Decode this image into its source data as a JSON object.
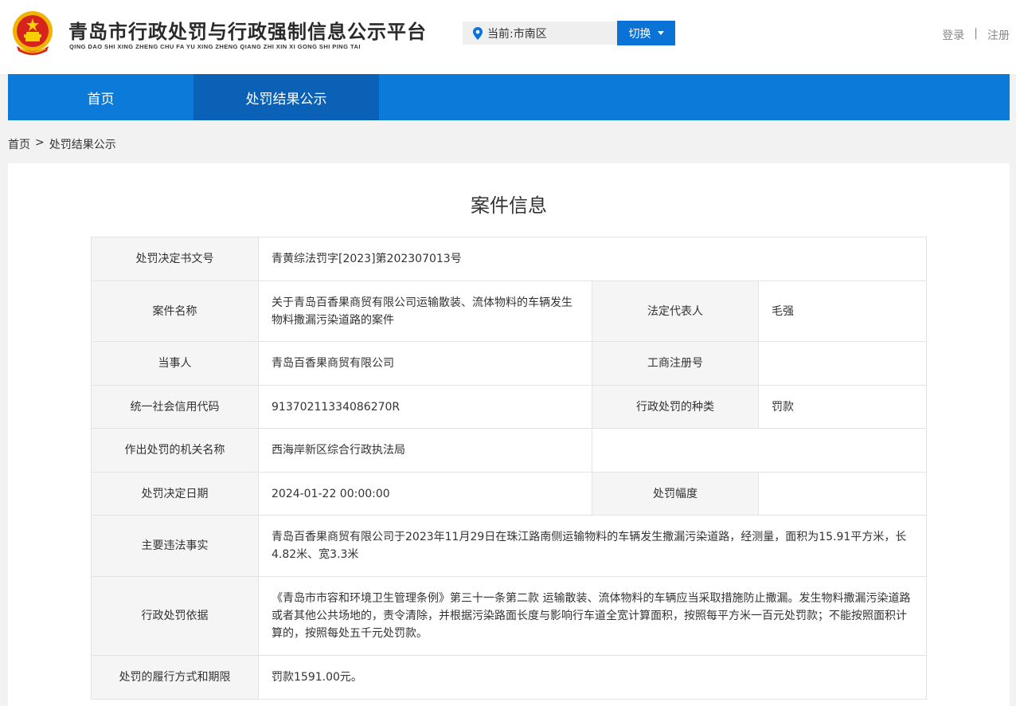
{
  "header": {
    "site_title": "青岛市行政处罚与行政强制信息公示平台",
    "site_subtitle": "QING DAO SHI XING ZHENG CHU FA YU XING ZHENG QIANG ZHI XIN XI GONG SHI PING TAI",
    "location_label": "当前:市南区",
    "switch_label": "切换",
    "login_label": "登录",
    "separator": "|",
    "register_label": "注册",
    "emblem_icon": "national-emblem-icon",
    "pin_icon": "location-pin-icon"
  },
  "nav": {
    "items": [
      {
        "label": "首页"
      },
      {
        "label": "处罚结果公示"
      }
    ],
    "active_index": 1
  },
  "breadcrumb": {
    "home": "首页",
    "separator": ">",
    "current": "处罚结果公示"
  },
  "panel": {
    "title": "案件信息"
  },
  "case": {
    "decision_no_label": "处罚决定书文号",
    "decision_no": "青黄综法罚字[2023]第202307013号",
    "case_name_label": "案件名称",
    "case_name": "关于青岛百香果商贸有限公司运输散装、流体物料的车辆发生物料撒漏污染道路的案件",
    "legal_rep_label": "法定代表人",
    "legal_rep": "毛强",
    "party_label": "当事人",
    "party": "青岛百香果商贸有限公司",
    "reg_no_label": "工商注册号",
    "reg_no": "",
    "credit_code_label": "统一社会信用代码",
    "credit_code": "91370211334086270R",
    "penalty_type_label": "行政处罚的种类",
    "penalty_type": "罚款",
    "authority_label": "作出处罚的机关名称",
    "authority": "西海岸新区综合行政执法局",
    "decision_date_label": "处罚决定日期",
    "decision_date": "2024-01-22 00:00:00",
    "penalty_range_label": "处罚幅度",
    "penalty_range": "",
    "facts_label": "主要违法事实",
    "facts": "青岛百香果商贸有限公司于2023年11月29日在珠江路南侧运输物料的车辆发生撒漏污染道路，经测量，面积为15.91平方米，长4.82米、宽3.3米",
    "basis_label": "行政处罚依据",
    "basis": "《青岛市市容和环境卫生管理条例》第三十一条第二款 运输散装、流体物料的车辆应当采取措施防止撒漏。发生物料撒漏污染道路或者其他公共场地的，责令清除，并根据污染路面长度与影响行车道全宽计算面积，按照每平方米一百元处罚款；不能按照面积计算的，按照每处五千元处罚款。",
    "execution_label": "处罚的履行方式和期限",
    "execution": "罚款1591.00元。"
  },
  "colors": {
    "nav_blue": "#0b7ad9",
    "nav_active": "#0a61b5",
    "button_blue": "#0b73d6",
    "label_bg": "#f5f5f5"
  }
}
